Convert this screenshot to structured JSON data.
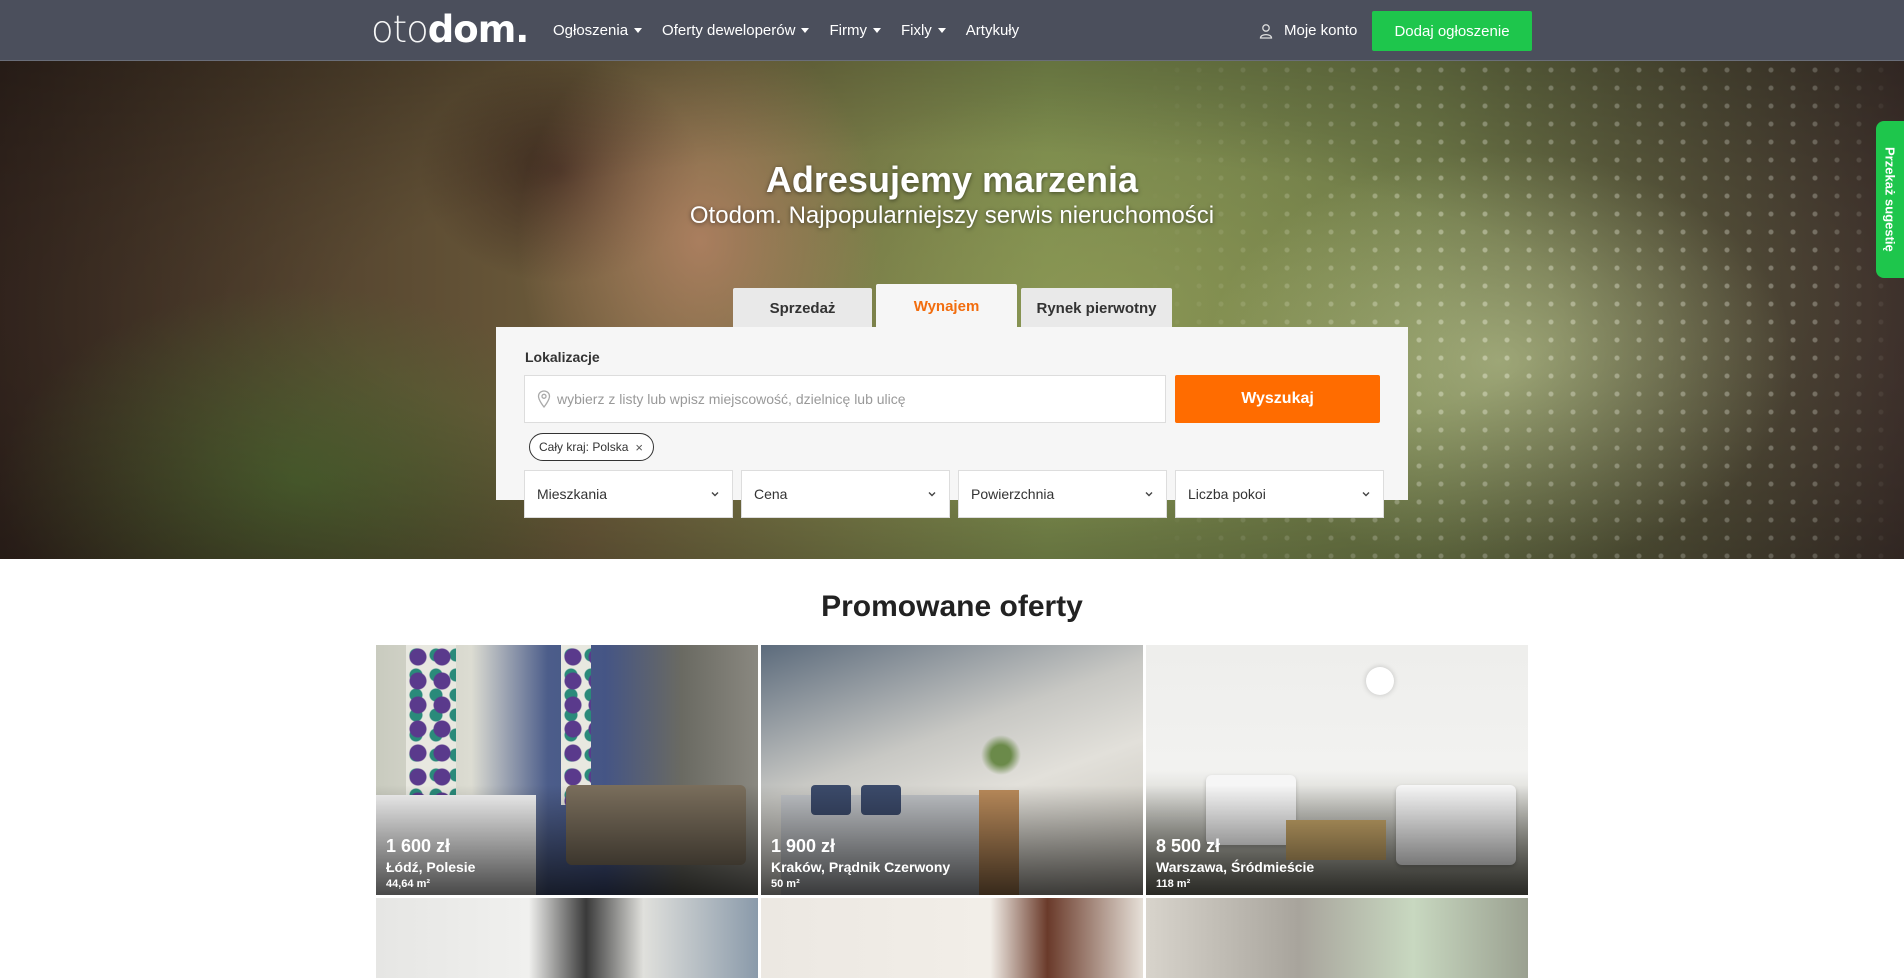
{
  "nav": {
    "logo_left": "oto",
    "logo_right": "dom.",
    "items": [
      {
        "label": "Ogłoszenia",
        "dropdown": true
      },
      {
        "label": "Oferty deweloperów",
        "dropdown": true
      },
      {
        "label": "Firmy",
        "dropdown": true
      },
      {
        "label": "Fixly",
        "dropdown": true
      },
      {
        "label": "Artykuły",
        "dropdown": false
      }
    ],
    "account_label": "Moje konto",
    "add_listing_label": "Dodaj ogłoszenie"
  },
  "hero": {
    "title": "Adresujemy marzenia",
    "subtitle": "Otodom. Najpopularniejszy serwis nieruchomości"
  },
  "search": {
    "tabs": [
      {
        "label": "Sprzedaż",
        "active": false
      },
      {
        "label": "Wynajem",
        "active": true
      },
      {
        "label": "Rynek pierwotny",
        "active": false
      }
    ],
    "location_label": "Lokalizacje",
    "location_placeholder": "wybierz z listy lub wpisz miejscowość, dzielnicę lub ulicę",
    "search_button": "Wyszukaj",
    "chip": "Cały kraj: Polska",
    "chip_remove": "×",
    "filters": [
      "Mieszkania",
      "Cena",
      "Powierzchnia",
      "Liczba pokoi"
    ]
  },
  "feedback_label": "Przekaż sugestię",
  "promoted": {
    "title": "Promowane oferty",
    "listings": [
      {
        "price": "1 600 zł",
        "location": "Łódź, Polesie",
        "area": "44,64 m²"
      },
      {
        "price": "1 900 zł",
        "location": "Kraków, Prądnik Czerwony",
        "area": "50 m²"
      },
      {
        "price": "8 500 zł",
        "location": "Warszawa, Śródmieście",
        "area": "118 m²"
      }
    ]
  },
  "colors": {
    "navbar": "#4b4f5c",
    "accent_green": "#1ec64c",
    "accent_orange": "#ff6c00",
    "tab_active_text": "#f26d0e"
  },
  "icons": {
    "account": "user-icon",
    "location": "map-pin-icon",
    "dropdown": "chevron-down-icon",
    "chip_remove": "close-icon"
  }
}
